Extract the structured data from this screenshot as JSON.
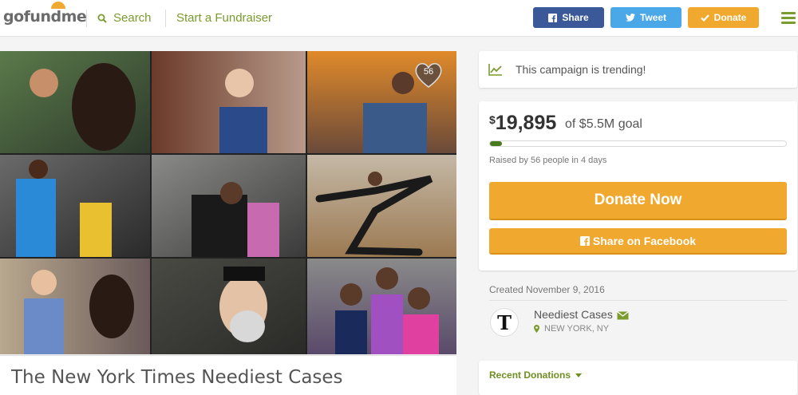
{
  "header": {
    "logo": {
      "go": "go",
      "fund": "fund",
      "me": "me"
    },
    "search_label": "Search",
    "start_label": "Start a Fundraiser",
    "share_label": "Share",
    "tweet_label": "Tweet",
    "donate_label": "Donate"
  },
  "campaign": {
    "title": "The New York Times Neediest Cases",
    "heart_count": "56",
    "trending_text": "This campaign is trending!",
    "amount_currency": "$",
    "amount_value": "19,895",
    "goal_text": "of $5.5M goal",
    "progress_fraction": 0.004,
    "raised_text": "Raised by 56 people in 4 days",
    "donate_now_label": "Donate Now",
    "share_facebook_label": "Share on Facebook",
    "created_text": "Created November 9, 2016",
    "organizer_name": "Neediest Cases",
    "organizer_location": "NEW YORK, NY",
    "organizer_logo_letter": "T",
    "recent_donations_label": "Recent Donations"
  },
  "colors": {
    "brand_green": "#7a9b2e",
    "facebook_blue": "#3b5998",
    "twitter_blue": "#4aa8e8",
    "donate_orange": "#f0a92e",
    "progress_green": "#4a7a1e"
  },
  "icons": [
    "search-icon",
    "facebook-icon",
    "twitter-icon",
    "check-icon",
    "menu-icon",
    "heart-icon",
    "trending-icon",
    "mail-icon",
    "location-pin-icon",
    "caret-down-icon"
  ]
}
